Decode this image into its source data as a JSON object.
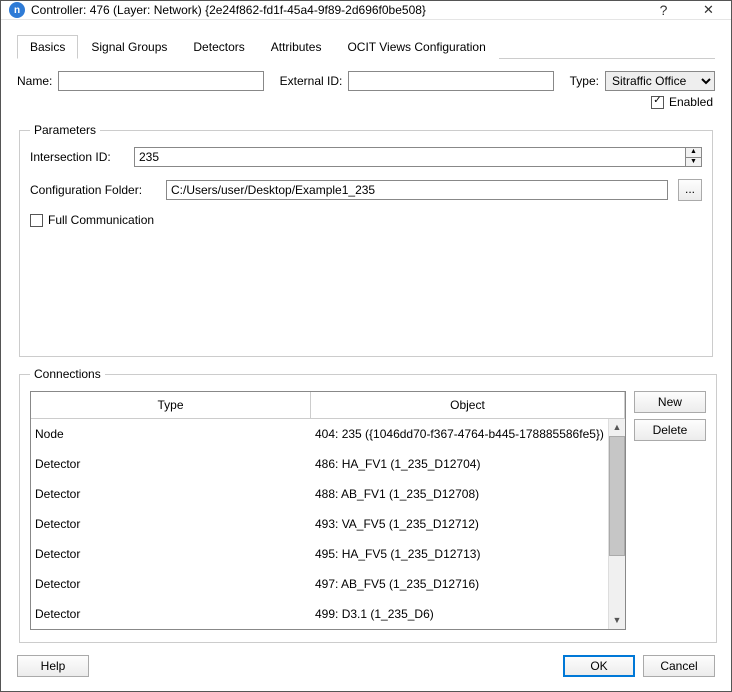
{
  "title": "Controller: 476 (Layer: Network) {2e24f862-fd1f-45a4-9f89-2d696f0be508}",
  "tabs": [
    "Basics",
    "Signal Groups",
    "Detectors",
    "Attributes",
    "OCIT Views Configuration"
  ],
  "activeTab": 0,
  "labels": {
    "name": "Name:",
    "externalId": "External ID:",
    "type": "Type:",
    "enabled": "Enabled",
    "parameters": "Parameters",
    "intersectionId": "Intersection ID:",
    "configFolder": "Configuration Folder:",
    "fullComm": "Full Communication",
    "connections": "Connections",
    "colType": "Type",
    "colObject": "Object"
  },
  "values": {
    "name": "",
    "externalId": "",
    "type": "Sitraffic Office",
    "enabled": true,
    "intersectionId": "235",
    "configFolder": "C:/Users/user/Desktop/Example1_235",
    "fullComm": false
  },
  "buttons": {
    "browse": "...",
    "new": "New",
    "delete": "Delete",
    "help": "Help",
    "ok": "OK",
    "cancel": "Cancel"
  },
  "connections": [
    {
      "type": "Node",
      "object": "404: 235 ({1046dd70-f367-4764-b445-178885586fe5})"
    },
    {
      "type": "Detector",
      "object": "486: HA_FV1 (1_235_D12704)"
    },
    {
      "type": "Detector",
      "object": "488: AB_FV1 (1_235_D12708)"
    },
    {
      "type": "Detector",
      "object": "493: VA_FV5 (1_235_D12712)"
    },
    {
      "type": "Detector",
      "object": "495: HA_FV5 (1_235_D12713)"
    },
    {
      "type": "Detector",
      "object": "497: AB_FV5 (1_235_D12716)"
    },
    {
      "type": "Detector",
      "object": "499: D3.1 (1_235_D6)"
    }
  ]
}
